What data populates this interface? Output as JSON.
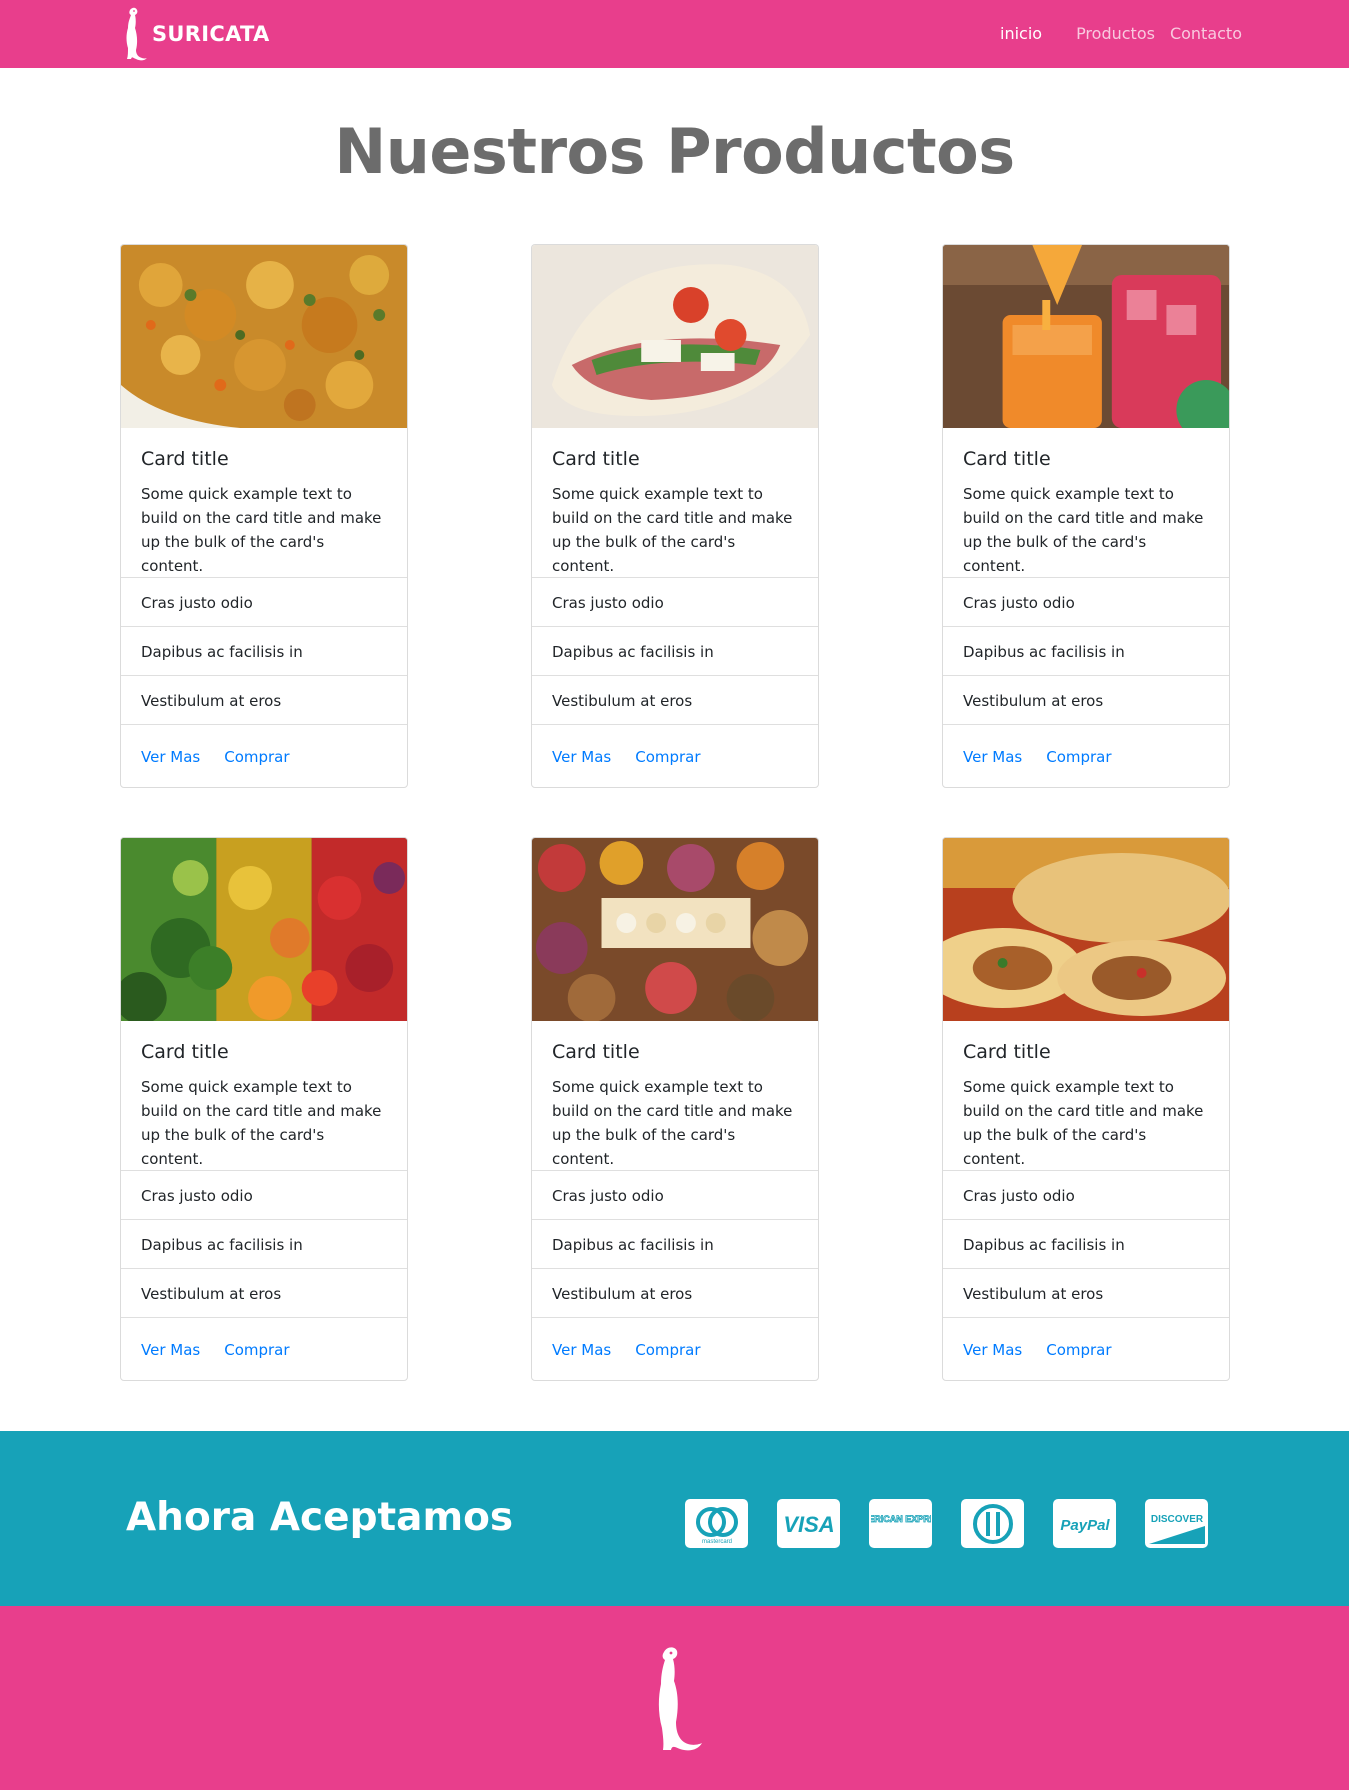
{
  "nav": {
    "brand": "SURICATA",
    "links": [
      "inicio",
      "Productos",
      "Contacto"
    ]
  },
  "page_title": "Nuestros Productos",
  "cards": [
    {
      "image": "food-stew",
      "title": "Card title",
      "text": "Some quick example text to build on the card title and make up the bulk of the card's content.",
      "items": [
        "Cras justo odio",
        "Dapibus ac facilisis in",
        "Vestibulum at eros"
      ],
      "links": [
        "Ver Mas",
        "Comprar"
      ]
    },
    {
      "image": "sandwich",
      "title": "Card title",
      "text": "Some quick example text to build on the card title and make up the bulk of the card's content.",
      "items": [
        "Cras justo odio",
        "Dapibus ac facilisis in",
        "Vestibulum at eros"
      ],
      "links": [
        "Ver Mas",
        "Comprar"
      ]
    },
    {
      "image": "drinks",
      "title": "Card title",
      "text": "Some quick example text to build on the card title and make up the bulk of the card's content.",
      "items": [
        "Cras justo odio",
        "Dapibus ac facilisis in",
        "Vestibulum at eros"
      ],
      "links": [
        "Ver Mas",
        "Comprar"
      ]
    },
    {
      "image": "vegetables",
      "title": "Card title",
      "text": "Some quick example text to build on the card title and make up the bulk of the card's content.",
      "items": [
        "Cras justo odio",
        "Dapibus ac facilisis in",
        "Vestibulum at eros"
      ],
      "links": [
        "Ver Mas",
        "Comprar"
      ]
    },
    {
      "image": "market-sweets",
      "title": "Card title",
      "text": "Some quick example text to build on the card title and make up the bulk of the card's content.",
      "items": [
        "Cras justo odio",
        "Dapibus ac facilisis in",
        "Vestibulum at eros"
      ],
      "links": [
        "Ver Mas",
        "Comprar"
      ]
    },
    {
      "image": "empanadas",
      "title": "Card title",
      "text": "Some quick example text to build on the card title and make up the bulk of the card's content.",
      "items": [
        "Cras justo odio",
        "Dapibus ac facilisis in",
        "Vestibulum at eros"
      ],
      "links": [
        "Ver Mas",
        "Comprar"
      ]
    }
  ],
  "payments": {
    "title": "Ahora Aceptamos",
    "methods": [
      {
        "icon": "mastercard-icon",
        "label": "mastercard"
      },
      {
        "icon": "visa-icon",
        "label": "VISA"
      },
      {
        "icon": "american-express-icon",
        "label": "AMERICAN EXPRESS"
      },
      {
        "icon": "diners-club-icon",
        "label": ""
      },
      {
        "icon": "paypal-icon",
        "label": "PayPal"
      },
      {
        "icon": "discover-icon",
        "label": "DISCOVER"
      }
    ]
  },
  "colors": {
    "brand_pink": "#e83e8c",
    "teal": "#17a2b8",
    "link_blue": "#007bff",
    "title_gray": "#6c6c6c"
  }
}
